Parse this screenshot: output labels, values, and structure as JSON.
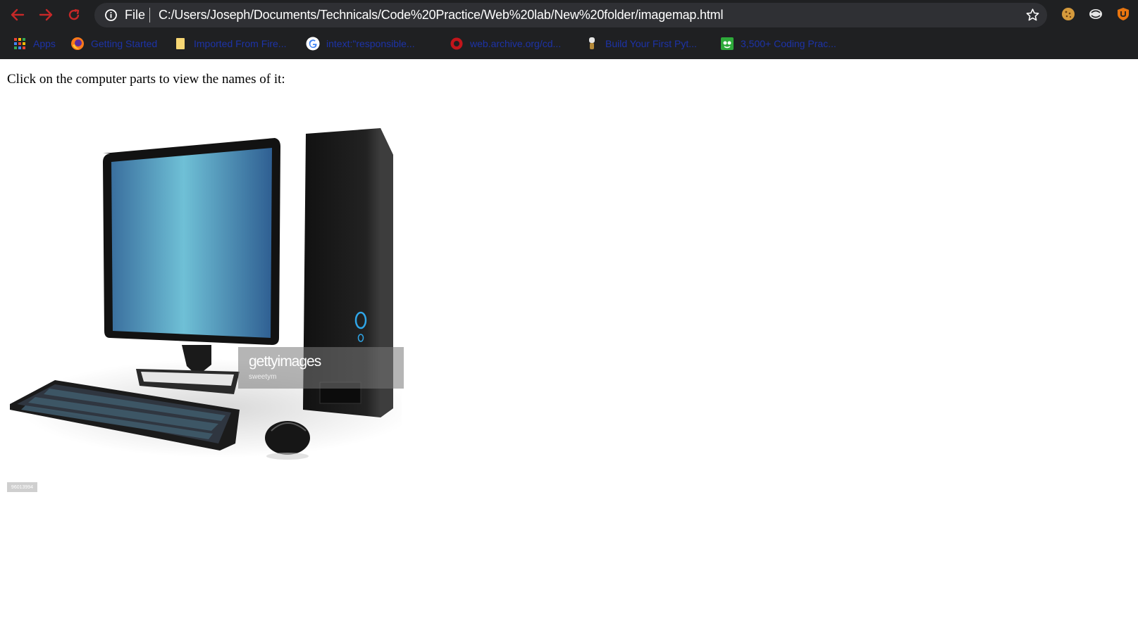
{
  "browser": {
    "omnibox": {
      "scheme_label": "File",
      "url": "C:/Users/Joseph/Documents/Technicals/Code%20Practice/Web%20lab/New%20folder/imagemap.html"
    },
    "nav_icons": [
      "back-arrow-icon",
      "forward-arrow-icon",
      "reload-icon"
    ],
    "extensions": [
      "cookie-icon",
      "extension-icon",
      "shield-icon"
    ],
    "bookmarks": [
      {
        "label": "Apps",
        "icon": "apps-grid-icon"
      },
      {
        "label": "Getting Started",
        "icon": "firefox-icon"
      },
      {
        "label": "Imported From Fire...",
        "icon": "folder-icon"
      },
      {
        "label": "intext:\"responsible...",
        "icon": "google-icon"
      },
      {
        "label": "web.archive.org/cd...",
        "icon": "archive-icon"
      },
      {
        "label": "Build Your First Pyt...",
        "icon": "python-icon"
      },
      {
        "label": "3,500+ Coding Prac...",
        "icon": "coding-icon"
      }
    ]
  },
  "page": {
    "intro_text": "Click on the computer parts to view the names of it:",
    "image": {
      "watermark": "gettyimages",
      "credit": "sweetym",
      "image_id": "96013994"
    }
  },
  "colors": {
    "chrome_bg": "#1f2022",
    "omnibox_bg": "#2f3034",
    "bookmark_text": "#1d33a8",
    "nav_icon": "#c62828"
  }
}
